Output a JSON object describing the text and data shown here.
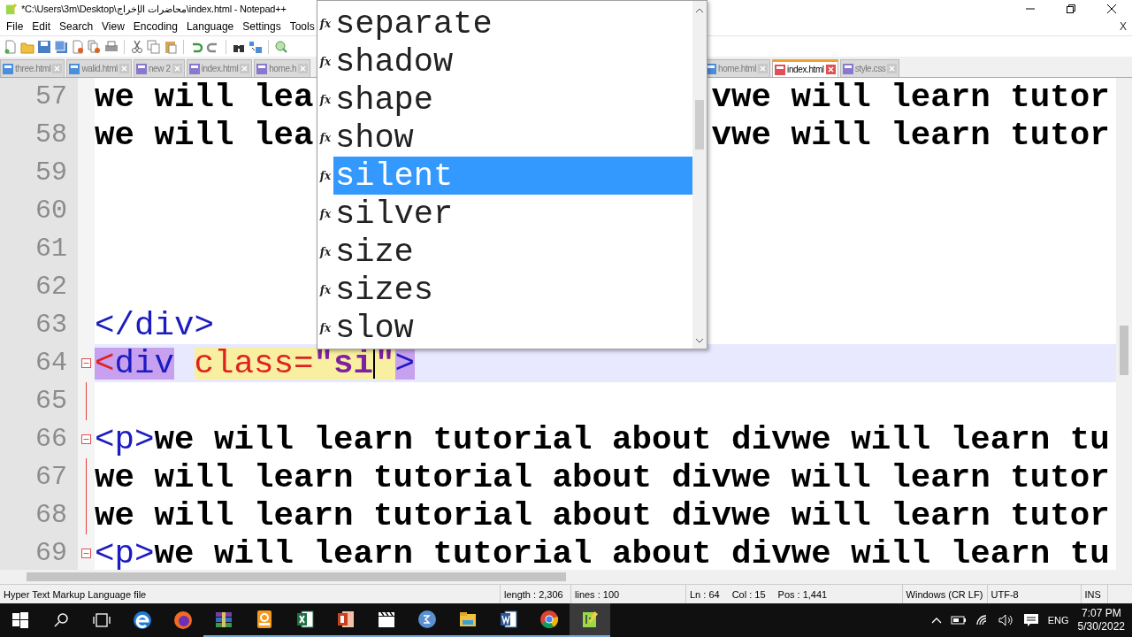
{
  "window": {
    "title": "*C:\\Users\\3m\\Desktop\\محاضرات الإخراج\\index.html - Notepad++",
    "close_doc": "X"
  },
  "menu": [
    "File",
    "Edit",
    "Search",
    "View",
    "Encoding",
    "Language",
    "Settings",
    "Tools"
  ],
  "tabs_left": [
    {
      "label": "three.html",
      "selected": false,
      "color": "#4a8fdc"
    },
    {
      "label": "walid.html",
      "selected": false,
      "color": "#4a8fdc"
    },
    {
      "label": "new 2",
      "selected": false,
      "color": "#8a78d0"
    },
    {
      "label": "index.html",
      "selected": false,
      "color": "#8a78d0"
    },
    {
      "label": "home.h",
      "selected": false,
      "color": "#8a78d0"
    }
  ],
  "tabs_right": [
    {
      "label": "home.html",
      "selected": false,
      "color": "#4a8fdc"
    },
    {
      "label": "index.html",
      "selected": true,
      "color": "#e0505a"
    },
    {
      "label": "style.css",
      "selected": false,
      "color": "#8a78d0"
    }
  ],
  "editor": {
    "lines": [
      {
        "number": "57",
        "current": false,
        "fold_start": false,
        "in_fold": false,
        "segments": [
          {
            "kind": "text",
            "text": "we will lea"
          },
          {
            "kind": "after_popup",
            "text": "vwe will learn tutor"
          }
        ]
      },
      {
        "number": "58",
        "current": false,
        "fold_start": false,
        "in_fold": false,
        "segments": [
          {
            "kind": "text",
            "text": "we will lea"
          },
          {
            "kind": "after_popup",
            "text": "vwe will learn tutor"
          }
        ]
      },
      {
        "number": "59",
        "current": false,
        "fold_start": false,
        "in_fold": false
      },
      {
        "number": "60",
        "current": false,
        "fold_start": false,
        "in_fold": false
      },
      {
        "number": "61",
        "current": false,
        "fold_start": false,
        "in_fold": false
      },
      {
        "number": "62",
        "current": false,
        "fold_start": false,
        "in_fold": false
      },
      {
        "number": "63",
        "current": false,
        "fold_start": false,
        "in_fold": false,
        "segments": [
          {
            "kind": "tag",
            "text": "</div>"
          }
        ]
      },
      {
        "number": "64",
        "current": true,
        "fold_start": true,
        "in_fold": false,
        "segments": [
          {
            "kind": "match_bracket",
            "text": "<"
          },
          {
            "kind": "match_tag",
            "text": "div"
          },
          {
            "kind": "attr",
            "text": "class="
          },
          {
            "kind": "value",
            "text": "\"si"
          },
          {
            "kind": "caret"
          },
          {
            "kind": "value",
            "text": "\""
          },
          {
            "kind": "match_tag",
            "text": ">"
          }
        ]
      },
      {
        "number": "65",
        "current": false,
        "fold_start": false,
        "in_fold": true
      },
      {
        "number": "66",
        "current": false,
        "fold_start": true,
        "in_fold": false,
        "segments": [
          {
            "kind": "tag",
            "text": "<p>"
          },
          {
            "kind": "text",
            "text": "we will learn tutorial about divwe will learn tu"
          }
        ]
      },
      {
        "number": "67",
        "current": false,
        "fold_start": false,
        "in_fold": true,
        "segments": [
          {
            "kind": "text",
            "text": "we will learn tutorial about divwe will learn tutor"
          }
        ]
      },
      {
        "number": "68",
        "current": false,
        "fold_start": false,
        "in_fold": true,
        "segments": [
          {
            "kind": "text",
            "text": "we will learn tutorial about divwe will learn tutor"
          }
        ]
      },
      {
        "number": "69",
        "current": false,
        "fold_start": true,
        "in_fold": false,
        "segments": [
          {
            "kind": "tag",
            "text": "<p>"
          },
          {
            "kind": "text",
            "text": "we will learn tutorial about divwe will learn tu"
          }
        ]
      }
    ]
  },
  "autocomplete": {
    "items": [
      {
        "icon": "fx",
        "label": "separate",
        "selected": false
      },
      {
        "icon": "fx",
        "label": "shadow",
        "selected": false
      },
      {
        "icon": "fx",
        "label": "shape",
        "selected": false
      },
      {
        "icon": "fx",
        "label": "show",
        "selected": false
      },
      {
        "icon": "fx",
        "label": "silent",
        "selected": true
      },
      {
        "icon": "fx",
        "label": "silver",
        "selected": false
      },
      {
        "icon": "fx",
        "label": "size",
        "selected": false
      },
      {
        "icon": "fx",
        "label": "sizes",
        "selected": false
      },
      {
        "icon": "fx",
        "label": "slow",
        "selected": false
      }
    ]
  },
  "status_bar": {
    "file_type": "Hyper Text Markup Language file",
    "length": "length : 2,306",
    "lines": "lines : 100",
    "ln": "Ln : 64",
    "col": "Col : 15",
    "pos": "Pos : 1,441",
    "eol": "Windows (CR LF)",
    "encoding": "UTF-8",
    "mode": "INS"
  },
  "taskbar": {
    "apps": [
      {
        "kind": "edge",
        "running": false,
        "selected": false
      },
      {
        "kind": "firefox",
        "running": false,
        "selected": false
      },
      {
        "kind": "winrar",
        "running": true,
        "selected": false
      },
      {
        "kind": "pdf",
        "running": true,
        "selected": false
      },
      {
        "kind": "excel",
        "running": true,
        "selected": false
      },
      {
        "kind": "powerpoint",
        "running": true,
        "selected": false
      },
      {
        "kind": "video",
        "running": true,
        "selected": false
      },
      {
        "kind": "math",
        "running": true,
        "selected": false
      },
      {
        "kind": "explorer",
        "running": true,
        "selected": false
      },
      {
        "kind": "word",
        "running": true,
        "selected": false
      },
      {
        "kind": "chrome",
        "running": true,
        "selected": false
      },
      {
        "kind": "notepad",
        "running": true,
        "selected": true
      }
    ],
    "language": "ENG",
    "time": "7:07 PM",
    "date": "5/30/2022"
  }
}
